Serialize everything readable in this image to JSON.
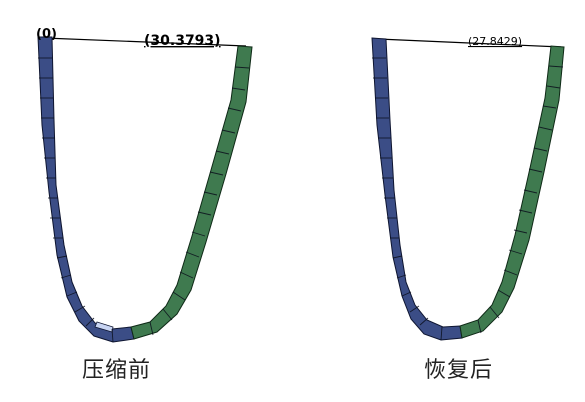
{
  "left_view": {
    "origin_label": "(0)",
    "distance_label": "(30.3793)",
    "state_label": "压缩前"
  },
  "right_view": {
    "distance_label": "(27.8429)",
    "state_label": "恢复后"
  },
  "colors": {
    "left_arm": "#3b4d86",
    "right_arm": "#3f7a4f",
    "highlight": "#c8d4f2"
  }
}
